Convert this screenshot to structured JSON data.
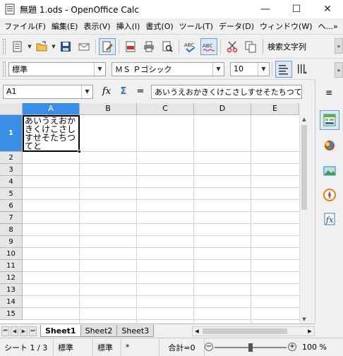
{
  "window": {
    "title": "無題 1.ods - OpenOffice Calc",
    "minimize": "—",
    "maximize": "☐",
    "close": "✕"
  },
  "menu": {
    "items": [
      "ファイル(F)",
      "編集(E)",
      "表示(V)",
      "挿入(I)",
      "書式(O)",
      "ツール(T)",
      "データ(D)",
      "ウィンドウ(W)",
      "ヘ...»"
    ]
  },
  "toolbar": {
    "search_label": "検索文字列",
    "icons": [
      "new-icon",
      "open-icon",
      "save-icon",
      "email-icon",
      "edit-file-icon",
      "export-pdf-icon",
      "print-icon",
      "print-preview-icon",
      "spellcheck-icon",
      "autospellcheck-icon",
      "cut-icon",
      "copy-icon"
    ]
  },
  "formatting": {
    "style": "標準",
    "font": "ＭＳ Ｐゴシック",
    "size": "10"
  },
  "formula_bar": {
    "name_box": "A1",
    "function_wizard": "fx",
    "sum": "Σ",
    "equals": "=",
    "content": "あいうえおかきくけこさしすせそたちつてと"
  },
  "sheet": {
    "columns": [
      "A",
      "B",
      "C",
      "D",
      "E"
    ],
    "rows": [
      "1",
      "2",
      "3",
      "4",
      "5",
      "6",
      "7",
      "8",
      "9",
      "10",
      "11",
      "12",
      "13",
      "14",
      "15"
    ],
    "selected_cell": "A1",
    "a1_value": "あいうえおかきくけこさしすせそたちつてと"
  },
  "tabs": {
    "nav": [
      "⏮",
      "◀",
      "▶",
      "⏭"
    ],
    "sheets": [
      "Sheet1",
      "Sheet2",
      "Sheet3"
    ],
    "active": "Sheet1"
  },
  "status": {
    "sheet_position": "シート 1 / 3",
    "page_style": "標準",
    "selection_mode": "標準",
    "modified": "*",
    "sum": "合計=0",
    "zoom": "100 %",
    "zoom_level": 0.5
  },
  "sidebar": {
    "menu": "≡",
    "icons": [
      "properties-icon",
      "styles-icon",
      "gallery-icon",
      "navigator-icon",
      "functions-icon"
    ]
  },
  "colors": {
    "selection_header": "#3a8ee6",
    "active_border": "#6b9bd8"
  }
}
